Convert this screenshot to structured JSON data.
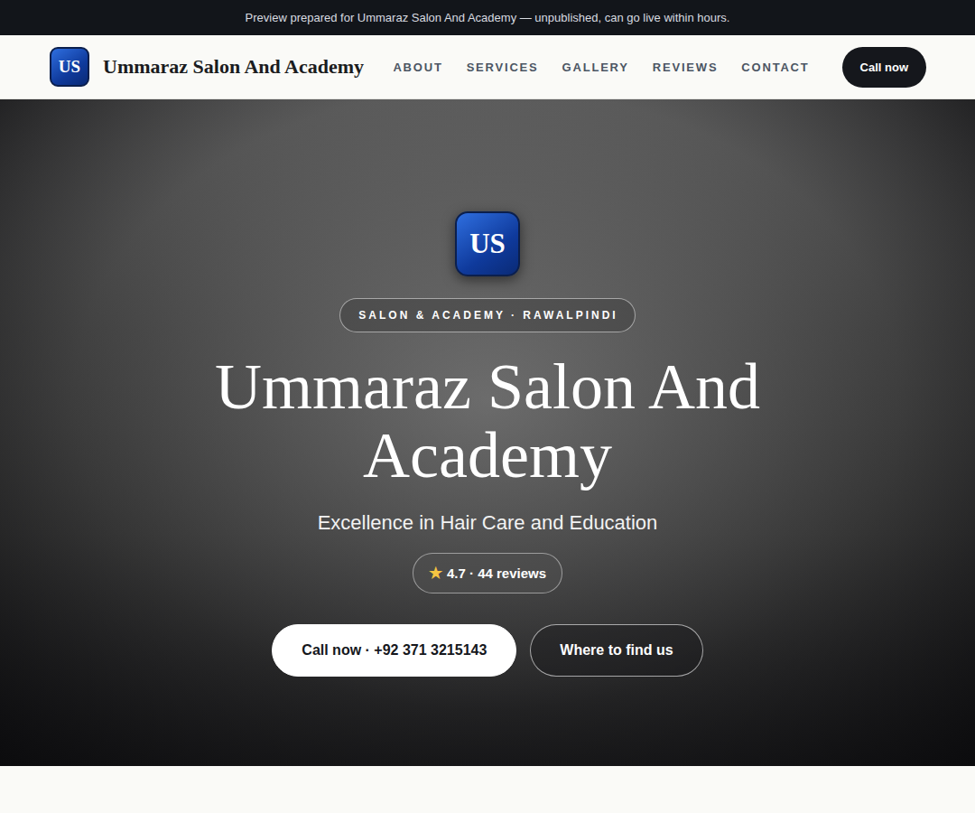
{
  "banner": {
    "text": "Preview prepared for Ummaraz Salon And Academy — unpublished, can go live within hours."
  },
  "brand": {
    "initials": "US",
    "name": "Ummaraz Salon And Academy"
  },
  "nav": {
    "links": [
      "ABOUT",
      "SERVICES",
      "GALLERY",
      "REVIEWS",
      "CONTACT"
    ],
    "cta": "Call now"
  },
  "hero": {
    "logo_initials": "US",
    "badge": "SALON & ACADEMY · RAWALPINDI",
    "title": "Ummaraz Salon And Academy",
    "subtitle": "Excellence in Hair Care and Education",
    "rating": {
      "star": "★",
      "text": "4.7 · 44 reviews"
    },
    "buttons": [
      {
        "label": "Call now · +92 371 3215143",
        "kind": "primary"
      },
      {
        "label": "Where to find us",
        "kind": "outline"
      }
    ]
  }
}
